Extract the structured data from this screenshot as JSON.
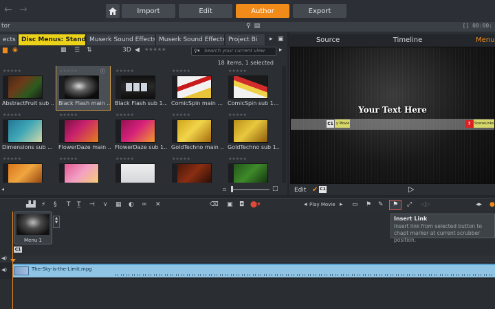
{
  "modes": [
    "Import",
    "Edit",
    "Author",
    "Export"
  ],
  "active_mode": "Author",
  "header": {
    "left_title": "tor",
    "timecode": "[] 00:00:"
  },
  "library": {
    "tabs": [
      "ects",
      "Disc Menus: Standard",
      "Muserk Sound Effects:...",
      "Muserk Sound Effects:...",
      "Project Bi"
    ],
    "tab_close": "×",
    "view_3d": "3D",
    "search_placeholder": "Search your current view",
    "item_count": "18 items, 1 selected",
    "items": [
      {
        "label": "AbstractFruit sub ...",
        "selected": false
      },
      {
        "label": "Black Flash main ...",
        "selected": true
      },
      {
        "label": "Black Flash sub 1...",
        "selected": false
      },
      {
        "label": "ComicSpin main ...",
        "selected": false
      },
      {
        "label": "ComicSpin sub 1...",
        "selected": false
      },
      {
        "label": "Dimensions sub ...",
        "selected": false
      },
      {
        "label": "FlowerDaze main ...",
        "selected": false
      },
      {
        "label": "FlowerDaze sub 1...",
        "selected": false
      },
      {
        "label": "GoldTechno main ...",
        "selected": false
      },
      {
        "label": "GoldTechno sub 1...",
        "selected": false
      },
      {
        "label": "",
        "selected": false
      },
      {
        "label": "",
        "selected": false
      },
      {
        "label": "",
        "selected": false
      },
      {
        "label": "",
        "selected": false
      },
      {
        "label": "",
        "selected": false
      }
    ]
  },
  "preview": {
    "tabs": [
      "Source",
      "Timeline",
      "Menu"
    ],
    "menu_text": "Your Text Here",
    "button1_label": "C1",
    "button1_text": "y Movie",
    "button2_text": "SceneLinks",
    "edit_label": "Edit",
    "chapter_label": "C1"
  },
  "timeline_toolbar": {
    "play_movie_label": "Play Movie",
    "tooltip_title": "Insert Link",
    "tooltip_body": "Insert link from selected button to chapt marker at current scrubber position."
  },
  "menu_track": {
    "menu_name": "Menu 1",
    "chapter_tag": "C1"
  },
  "audio_clip": {
    "name": "The-Sky-is-the-Limit.mpg"
  },
  "colors": {
    "accent": "#f08a19",
    "active_tab": "#ecd218",
    "audio_clip": "#8fc4e4"
  }
}
